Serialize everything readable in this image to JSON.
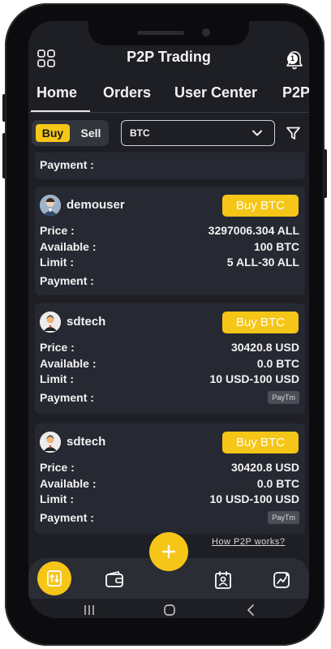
{
  "header": {
    "title": "P2P Trading",
    "notification_count": "1"
  },
  "tabs": [
    "Home",
    "Orders",
    "User Center",
    "P2P"
  ],
  "filter": {
    "buy_label": "Buy",
    "sell_label": "Sell",
    "coin_value": "BTC"
  },
  "labels": {
    "price": "Price :",
    "available": "Available :",
    "limit": "Limit :",
    "payment": "Payment :"
  },
  "partial_card": {
    "payment_label": "Payment :"
  },
  "offers": [
    {
      "user": "demouser",
      "button": "Buy BTC",
      "price": "3297006.304 ALL",
      "available": "100 BTC",
      "limit": "5 ALL-30 ALL",
      "payment": ""
    },
    {
      "user": "sdtech",
      "button": "Buy BTC",
      "price": "30420.8 USD",
      "available": "0.0 BTC",
      "limit": "10 USD-100 USD",
      "payment": "PayTm"
    },
    {
      "user": "sdtech",
      "button": "Buy BTC",
      "price": "30420.8 USD",
      "available": "0.0 BTC",
      "limit": "10 USD-100 USD",
      "payment": "PayTm"
    }
  ],
  "how_link": "How P2P works?",
  "colors": {
    "accent": "#f5c518",
    "background": "#1e1f25",
    "card": "#272932"
  },
  "icons": {
    "menu": "grid-icon",
    "notifications": "bell-icon",
    "filter": "funnel-icon",
    "fab": "plus-icon",
    "nav": [
      "exchange-icon",
      "wallet-icon",
      "contact-card-icon",
      "chart-icon"
    ]
  }
}
